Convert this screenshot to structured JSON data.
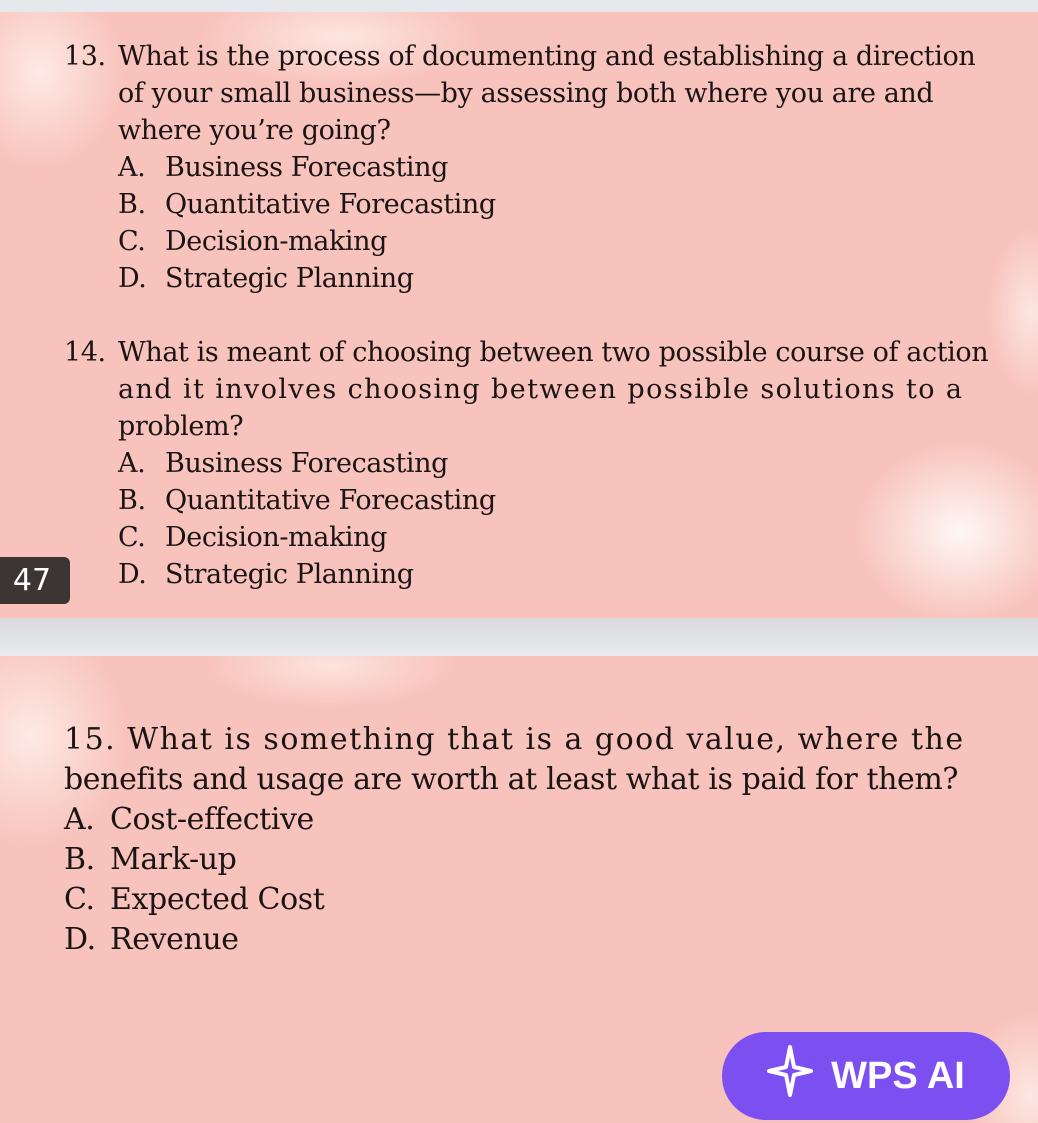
{
  "page_badge": "47",
  "questions": [
    {
      "number": "13.",
      "stem_lines": [
        "What is the process of documenting and establishing a direction",
        "of your small business—by assessing both where you are and",
        "where you’re going?"
      ],
      "options": [
        {
          "letter": "A.",
          "text": "Business Forecasting"
        },
        {
          "letter": "B.",
          "text": "Quantitative Forecasting"
        },
        {
          "letter": "C.",
          "text": "Decision-making"
        },
        {
          "letter": "D.",
          "text": "Strategic Planning"
        }
      ]
    },
    {
      "number": "14.",
      "stem_lines": [
        "What is meant of choosing between two possible course of action",
        "and it involves choosing between possible solutions to a",
        "problem?"
      ],
      "options": [
        {
          "letter": "A.",
          "text": "Business Forecasting"
        },
        {
          "letter": "B.",
          "text": "Quantitative Forecasting"
        },
        {
          "letter": "C.",
          "text": "Decision-making"
        },
        {
          "letter": "D.",
          "text": "Strategic Planning"
        }
      ]
    },
    {
      "number": "15.",
      "stem_lines": [
        "What is something that is a good value, where the",
        "benefits and usage are worth at least what is paid for them?"
      ],
      "options": [
        {
          "letter": "A.",
          "text": "Cost-effective"
        },
        {
          "letter": "B.",
          "text": "Mark-up"
        },
        {
          "letter": "C.",
          "text": "Expected Cost"
        },
        {
          "letter": "D.",
          "text": "Revenue"
        }
      ]
    }
  ],
  "wps_ai": {
    "label": "WPS AI",
    "icon": "sparkle-star-icon",
    "color": "#7b4ff0"
  }
}
